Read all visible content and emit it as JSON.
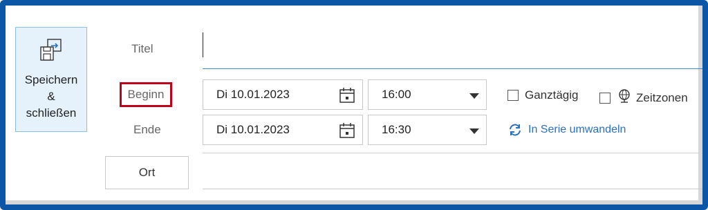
{
  "save_button": {
    "label_line1": "Speichern",
    "label_line2": "&",
    "label_line3": "schließen",
    "icon": "save-close-icon"
  },
  "labels": {
    "title": "Titel",
    "begin": "Beginn",
    "end": "Ende"
  },
  "location_button": {
    "label": "Ort"
  },
  "title_input": {
    "value": ""
  },
  "start": {
    "date": "Di 10.01.2023",
    "time": "16:00"
  },
  "end": {
    "date": "Di 10.01.2023",
    "time": "16:30"
  },
  "options": {
    "all_day": {
      "label": "Ganztägig",
      "checked": false
    },
    "time_zones": {
      "label": "Zeitzonen",
      "checked": false,
      "icon": "globe-icon"
    },
    "recurrence_link": {
      "label": "In Serie umwandeln",
      "icon": "recurrence-icon"
    }
  },
  "colors": {
    "frame": "#0b57a6",
    "highlight": "#c00018",
    "link": "#2b6fbf",
    "save_bg": "#e5f1fb"
  }
}
